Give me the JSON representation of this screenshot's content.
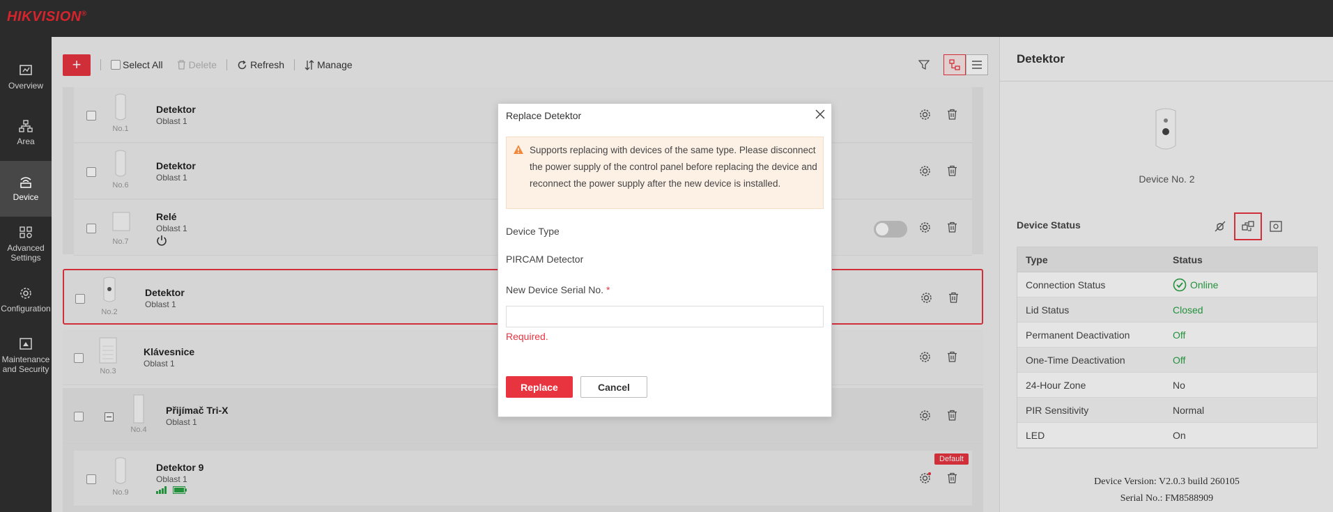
{
  "app": {
    "logo": "HIKVISION",
    "logo_mark": "®"
  },
  "nav": {
    "items": [
      {
        "label": "Overview",
        "icon": "overview-icon"
      },
      {
        "label": "Area",
        "icon": "area-icon"
      },
      {
        "label": "Device",
        "icon": "device-icon",
        "active": true
      },
      {
        "label": "Advanced Settings",
        "icon": "advanced-settings-icon"
      },
      {
        "label": "Configuration",
        "icon": "configuration-icon"
      },
      {
        "label": "Maintenance and Security",
        "icon": "maintenance-icon"
      }
    ]
  },
  "toolbar": {
    "add": "+",
    "select_all": "Select All",
    "delete": "Delete",
    "refresh": "Refresh",
    "manage": "Manage"
  },
  "devices": [
    {
      "name": "Detektor",
      "area": "Oblast 1",
      "no": "No.1"
    },
    {
      "name": "Detektor",
      "area": "Oblast 1",
      "no": "No.6"
    },
    {
      "name": "Relé",
      "area": "Oblast 1",
      "no": "No.7"
    },
    {
      "name": "Detektor",
      "area": "Oblast 1",
      "no": "No.2"
    },
    {
      "name": "Klávesnice",
      "area": "Oblast 1",
      "no": "No.3"
    },
    {
      "name": "Přijímač Tri-X",
      "area": "Oblast 1",
      "no": "No.4"
    },
    {
      "name": "Detektor 9",
      "area": "Oblast 1",
      "no": "No.9",
      "badge": "Default"
    }
  ],
  "right_panel": {
    "title": "Detektor",
    "device_name": "Device No. 2",
    "status_title": "Device Status",
    "table_head": {
      "type": "Type",
      "status": "Status"
    },
    "rows": [
      {
        "type": "Connection Status",
        "status": "Online"
      },
      {
        "type": "Lid Status",
        "status": "Closed"
      },
      {
        "type": "Permanent Deactivation",
        "status": "Off"
      },
      {
        "type": "One-Time Deactivation",
        "status": "Off"
      },
      {
        "type": "24-Hour Zone",
        "status": "No"
      },
      {
        "type": "PIR Sensitivity",
        "status": "Normal"
      },
      {
        "type": "LED",
        "status": "On"
      }
    ],
    "version": "Device Version: V2.0.3 build 260105",
    "serial": "Serial No.: FM8588909"
  },
  "modal": {
    "title": "Replace Detektor",
    "warning": "Supports replacing with devices of the same type. Please disconnect the power supply of the control panel before replacing the device and reconnect the power supply after the new device is installed.",
    "device_type_label": "Device Type",
    "device_type_value": "PIRCAM Detector",
    "serial_label": "New Device Serial No.",
    "required_mark": "*",
    "serial_value": "",
    "error": "Required.",
    "replace": "Replace",
    "cancel": "Cancel"
  },
  "colors": {
    "accent": "#e8343f",
    "online": "#27a243",
    "nav_bg": "#2b2b2b"
  }
}
